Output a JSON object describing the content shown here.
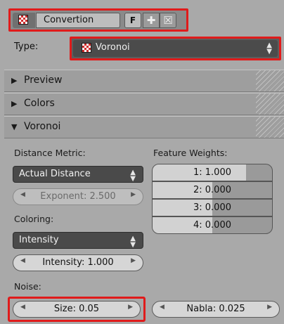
{
  "texture": {
    "name": "Convertion",
    "fake_user": "F"
  },
  "type": {
    "label": "Type:",
    "value": "Voronoi"
  },
  "sections": {
    "preview": "Preview",
    "colors": "Colors",
    "voronoi": "Voronoi"
  },
  "voronoi": {
    "distance_metric_label": "Distance Metric:",
    "distance_metric_value": "Actual Distance",
    "exponent": "Exponent: 2.500",
    "coloring_label": "Coloring:",
    "coloring_value": "Intensity",
    "intensity": "Intensity: 1.000",
    "feature_weights_label": "Feature Weights:",
    "weights": [
      {
        "label": "1: 1.000",
        "fill": 0.78
      },
      {
        "label": "2: 0.000",
        "fill": 0.5
      },
      {
        "label": "3: 0.000",
        "fill": 0.5
      },
      {
        "label": "4: 0.000",
        "fill": 0.5
      }
    ],
    "noise_label": "Noise:",
    "size": "Size: 0.05",
    "nabla": "Nabla: 0.025"
  },
  "colors": {
    "highlight": "#e01b1b"
  }
}
